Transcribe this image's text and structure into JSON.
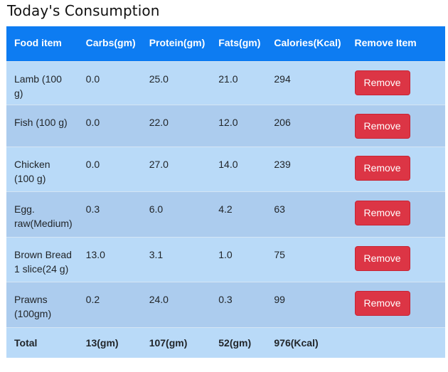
{
  "page": {
    "title": "Today's Consumption"
  },
  "table": {
    "headers": {
      "food": "Food item",
      "carbs": "Carbs(gm)",
      "protein": "Protein(gm)",
      "fats": "Fats(gm)",
      "calories": "Calories(Kcal)",
      "remove": "Remove Item"
    },
    "rows": [
      {
        "food": "Lamb (100 g)",
        "carbs": "0.0",
        "protein": "25.0",
        "fats": "21.0",
        "calories": "294",
        "action": "Remove"
      },
      {
        "food": "Fish (100 g)",
        "carbs": "0.0",
        "protein": "22.0",
        "fats": "12.0",
        "calories": "206",
        "action": "Remove"
      },
      {
        "food": "Chicken (100 g)",
        "carbs": "0.0",
        "protein": "27.0",
        "fats": "14.0",
        "calories": "239",
        "action": "Remove"
      },
      {
        "food": "Egg. raw(Medium)",
        "carbs": "0.3",
        "protein": "6.0",
        "fats": "4.2",
        "calories": "63",
        "action": "Remove"
      },
      {
        "food": "Brown Bread 1 slice(24 g)",
        "carbs": "13.0",
        "protein": "3.1",
        "fats": "1.0",
        "calories": "75",
        "action": "Remove"
      },
      {
        "food": "Prawns (100gm)",
        "carbs": "0.2",
        "protein": "24.0",
        "fats": "0.3",
        "calories": "99",
        "action": "Remove"
      }
    ],
    "totals": {
      "label": "Total",
      "carbs": "13(gm)",
      "protein": "107(gm)",
      "fats": "52(gm)",
      "calories": "976(Kcal)"
    }
  },
  "colors": {
    "header_bg": "#0d7cf2",
    "row_odd": "#b9daf8",
    "row_even": "#acccee",
    "remove_button": "#dc3545"
  }
}
